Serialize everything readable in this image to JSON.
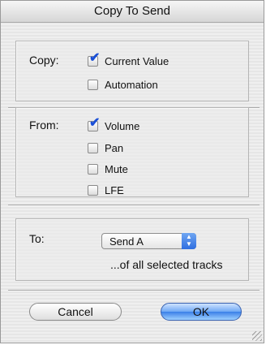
{
  "dialog": {
    "title": "Copy To Send"
  },
  "copy": {
    "label": "Copy:",
    "options": [
      {
        "label": "Current Value",
        "checked": true
      },
      {
        "label": "Automation",
        "checked": false
      }
    ]
  },
  "from": {
    "label": "From:",
    "options": [
      {
        "label": "Volume",
        "checked": true
      },
      {
        "label": "Pan",
        "checked": false
      },
      {
        "label": "Mute",
        "checked": false
      },
      {
        "label": "LFE",
        "checked": false
      }
    ]
  },
  "to": {
    "label": "To:",
    "selected": "Send A",
    "suffix": "...of all selected tracks"
  },
  "buttons": {
    "cancel": "Cancel",
    "ok": "OK"
  },
  "icons": {
    "checkmark": "✔"
  }
}
